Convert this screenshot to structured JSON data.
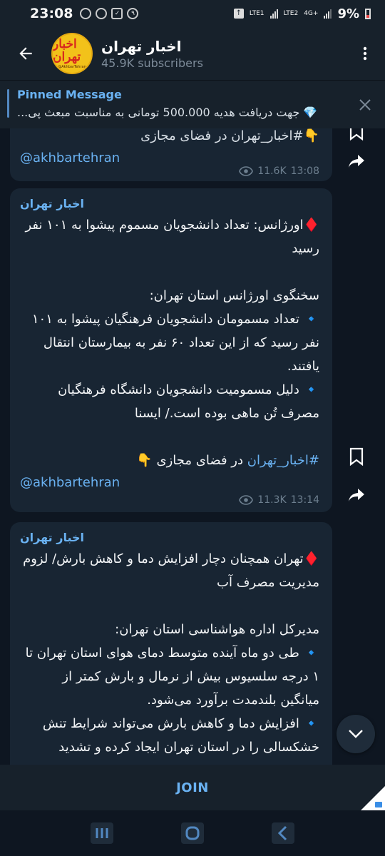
{
  "status_bar": {
    "time": "23:08",
    "notif_badge": "۹",
    "net1": "LTE1",
    "net2": "LTE2",
    "net_gen": "4G+",
    "battery": "9%"
  },
  "header": {
    "title": "اخبار تهران",
    "subscribers": "45.9K subscribers",
    "avatar_text": "اخبار تهران",
    "avatar_sub": "@AkhbarTehran"
  },
  "pinned": {
    "title": "Pinned Message",
    "text": "💎 جهت دریافت هدیه 500.000 تومانی به مناسبت مبعث پی..."
  },
  "messages": [
    {
      "partial_top": "👇#اخبار_تهران در فضای مجازی",
      "handle": "@akhbartehran",
      "views": "11.6K",
      "time": "13:08"
    },
    {
      "author": "اخبار تهران",
      "headline": "♦️اورژانس: تعداد دانشجویان مسموم پیشوا به ۱۰۱ نفر رسید",
      "source_line": "سخنگوی اورژانس استان تهران:",
      "bullet1": "🔹 تعداد مسمومان دانشجویان فرهنگیان پیشوا به ۱۰۱ نفر رسید که از این تعداد ۶۰ نفر به بیمارستان انتقال یافتند.",
      "bullet2": "🔹 دلیل مسمومیت دانشجویان دانشگاه فرهنگیان مصرف تُن ماهی بوده است./ ایسنا",
      "hashtag": "#اخبار_تهران",
      "hashtag_suffix": " در فضای مجازی 👇",
      "handle": "@akhbartehran",
      "views": "11.3K",
      "time": "13:14"
    },
    {
      "author": "اخبار تهران",
      "headline": "♦️تهران همچنان دچار افزایش دما و کاهش بارش/ لزوم مدیریت مصرف آب",
      "source_line": "مدیرکل اداره هواشناسی استان تهران:",
      "bullet1": "🔹 طی دو ماه آینده متوسط دمای هوای استان تهران تا ۱ درجه سلسیوس بیش از نرمال و بارش کمتر از میانگین بلندمدت برآورد می‌شود.",
      "bullet2": "🔹 افزایش دما و کاهش بارش می‌تواند شرایط تنش خشکسالی را در استان تهران ایجاد کرده و تشدید"
    }
  ],
  "join_label": "JOIN",
  "colors": {
    "accent": "#6ab2f2",
    "bubble": "#182533",
    "background": "#0e1621",
    "header": "#17212b"
  }
}
